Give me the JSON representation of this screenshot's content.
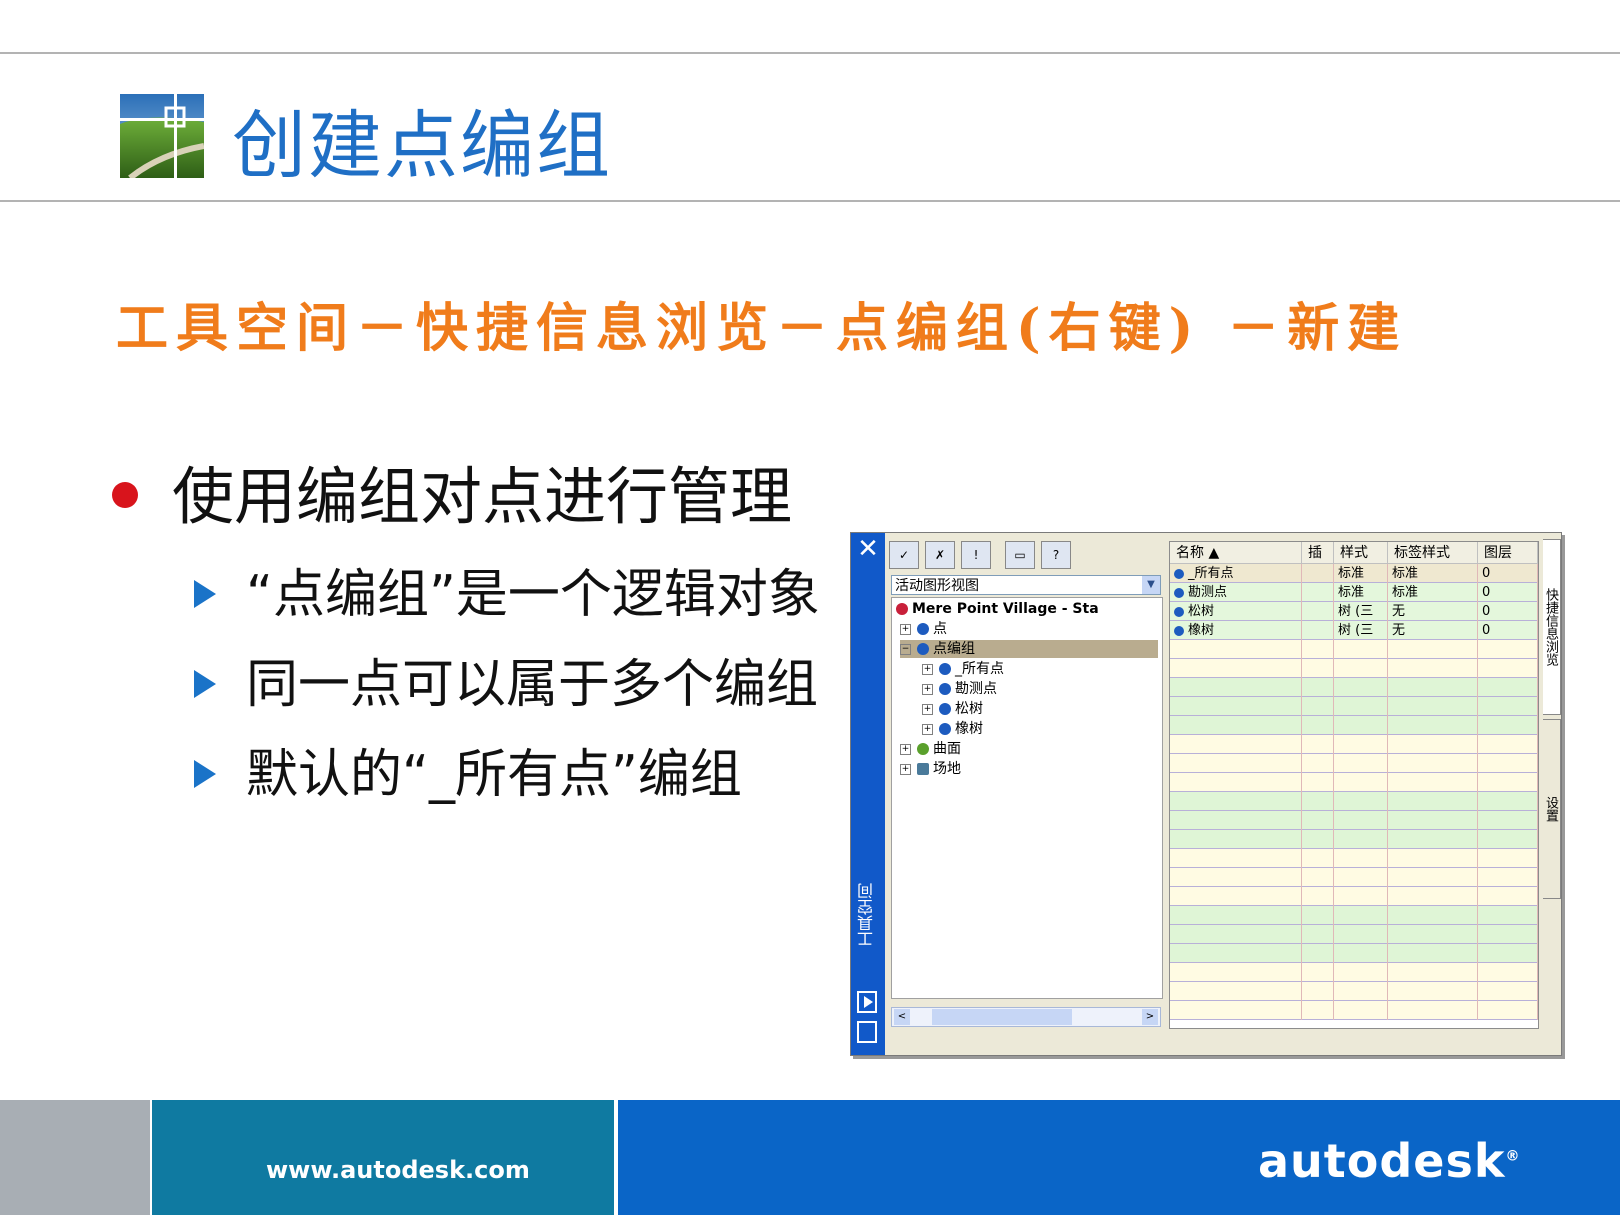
{
  "slide": {
    "title": "创建点编组",
    "subtitle": "工具空间－快捷信息浏览－点编组(右键) －新建",
    "bullet": "使用编组对点进行管理",
    "subbullets": [
      "“点编组”是一个逻辑对象",
      "同一点可以属于多个编组",
      "默认的“_所有点”编组"
    ]
  },
  "footer": {
    "url": "www.autodesk.com",
    "brand": "autodesk",
    "brand_mark": "®"
  },
  "toolspace": {
    "close_glyph": "✕",
    "vertical_title": "工具空间",
    "toolbar_buttons": [
      "✓",
      "✗",
      "!",
      "▭",
      "?"
    ],
    "view_select": "活动图形视图",
    "tree": [
      {
        "label": "Mere Point Village - Sta",
        "level": 0,
        "toggle": ""
      },
      {
        "label": "点",
        "level": 1,
        "toggle": "+"
      },
      {
        "label": "点编组",
        "level": 1,
        "toggle": "−",
        "selected": true
      },
      {
        "label": "_所有点",
        "level": 2,
        "toggle": "+"
      },
      {
        "label": "勘测点",
        "level": 2,
        "toggle": "+"
      },
      {
        "label": "松树",
        "level": 2,
        "toggle": "+"
      },
      {
        "label": "橡树",
        "level": 2,
        "toggle": "+"
      },
      {
        "label": "曲面",
        "level": 1,
        "toggle": "+"
      },
      {
        "label": "场地",
        "level": 1,
        "toggle": "+"
      }
    ],
    "grid": {
      "columns": [
        "名称 ▲",
        "插",
        "样式",
        "标签样式",
        "图层"
      ],
      "rows": [
        [
          "_所有点",
          "",
          "标准",
          "标准",
          "0"
        ],
        [
          "勘测点",
          "",
          "标准",
          "标准",
          "0"
        ],
        [
          "松树",
          "",
          "树 (三",
          "无",
          "0"
        ],
        [
          "橡树",
          "",
          "树 (三",
          "无",
          "0"
        ]
      ]
    },
    "right_tabs": [
      "快捷信息浏览",
      "设置"
    ],
    "scroll_left": "<",
    "scroll_right": ">"
  }
}
